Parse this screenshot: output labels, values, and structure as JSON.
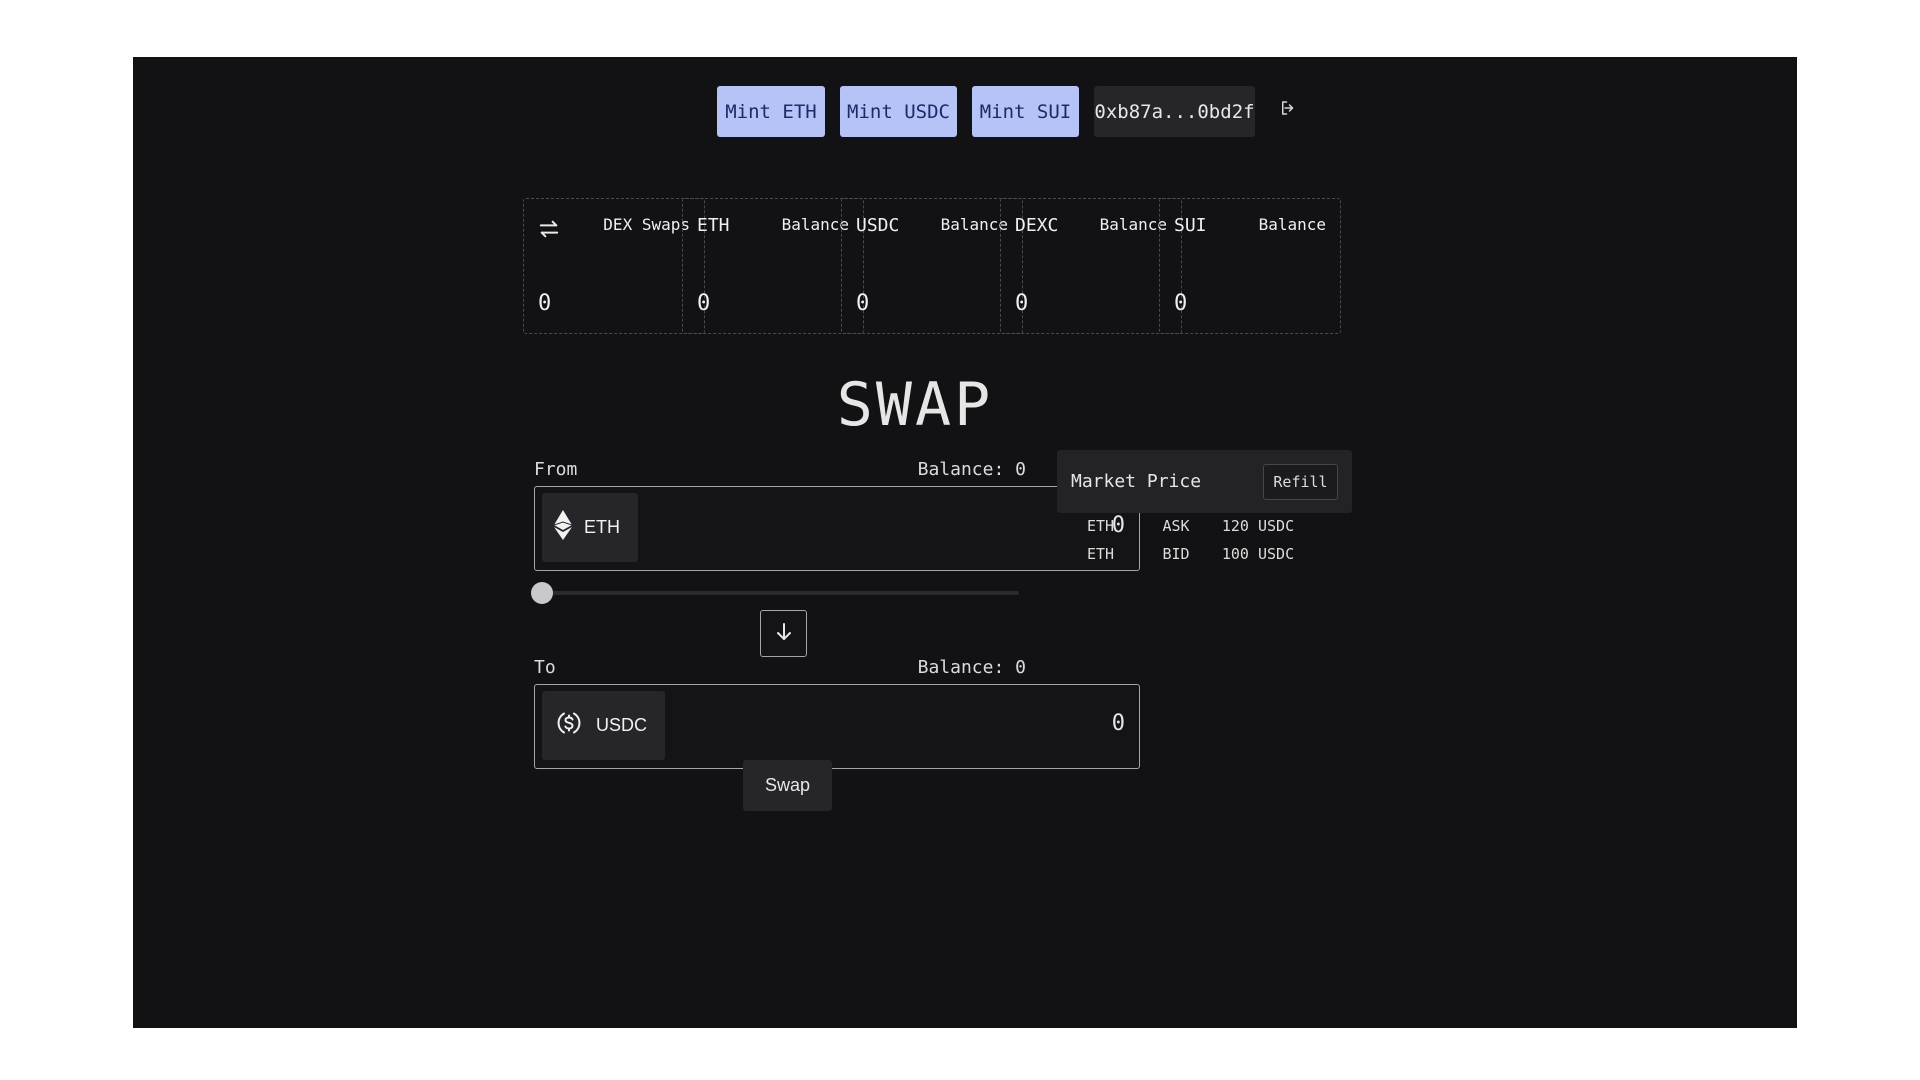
{
  "topbar": {
    "mint_buttons": [
      "Mint ETH",
      "Mint USDC",
      "Mint SUI"
    ],
    "wallet_address": "0xb87a...0bd2f",
    "logout_icon": "logout-icon"
  },
  "stats": [
    {
      "token": "",
      "label": "DEX Swaps",
      "value": "0",
      "icon": "swap-arrows-icon"
    },
    {
      "token": "ETH",
      "label": "Balance",
      "value": "0"
    },
    {
      "token": "USDC",
      "label": "Balance",
      "value": "0"
    },
    {
      "token": "DEXC",
      "label": "Balance",
      "value": "0"
    },
    {
      "token": "SUI",
      "label": "Balance",
      "value": "0"
    }
  ],
  "swap": {
    "title": "SWAP",
    "from": {
      "label": "From",
      "balance": "Balance: 0",
      "token": "ETH",
      "amount": "0",
      "icon": "ethereum-icon"
    },
    "slider_value": 0,
    "to": {
      "label": "To",
      "balance": "Balance: 0",
      "token": "USDC",
      "amount": "0",
      "icon": "usdc-icon"
    },
    "swap_button": "Swap",
    "direction_icon": "arrow-down-icon"
  },
  "market": {
    "title": "Market Price",
    "refill_button": "Refill",
    "rows": [
      {
        "token": "ETH",
        "side": "ASK",
        "price": "120 USDC"
      },
      {
        "token": "ETH",
        "side": "BID",
        "price": "100 USDC"
      }
    ]
  },
  "colors": {
    "app_background": "#121214",
    "mint_button_bg": "#b5c3f7",
    "mint_button_text": "#1e2a66"
  }
}
